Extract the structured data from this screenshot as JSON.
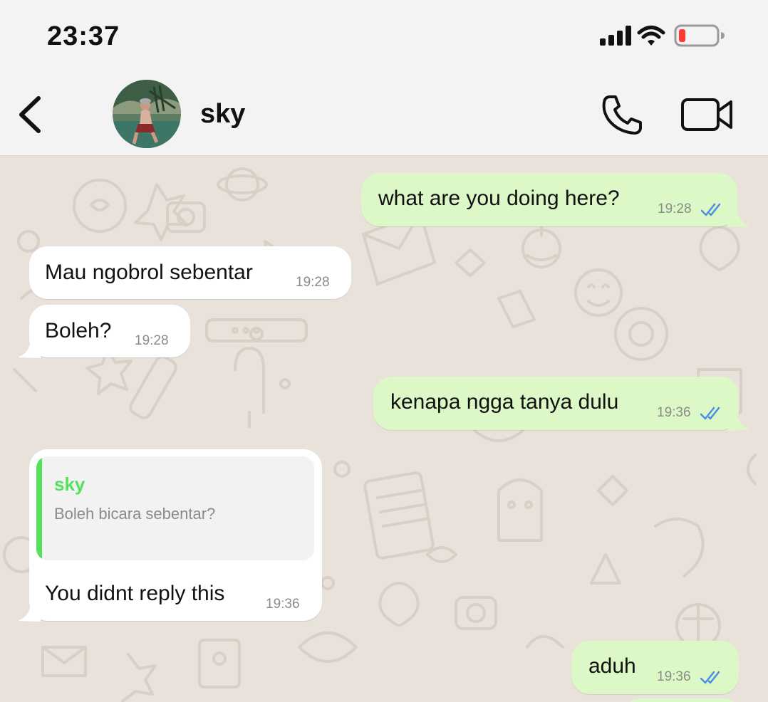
{
  "status_bar": {
    "time": "23:37",
    "signal_icon": "cellular-signal-icon",
    "wifi_icon": "wifi-icon",
    "battery_icon": "battery-low-icon",
    "battery_color": "#ff3b30"
  },
  "header": {
    "back_icon": "chevron-left-icon",
    "contact_name": "sky",
    "call_icon": "phone-icon",
    "video_icon": "video-camera-icon"
  },
  "colors": {
    "outgoing_bubble": "#dcf8c6",
    "incoming_bubble": "#ffffff",
    "read_ticks": "#4a90e2",
    "reply_accent": "#55e15a",
    "chat_background": "#e9e2db"
  },
  "messages": [
    {
      "direction": "outgoing",
      "text": "what are you doing here?",
      "time": "19:28",
      "read": true
    },
    {
      "direction": "incoming",
      "text": "Mau ngobrol sebentar",
      "time": "19:28"
    },
    {
      "direction": "incoming",
      "text": "Boleh?",
      "time": "19:28"
    },
    {
      "direction": "outgoing",
      "text": "kenapa ngga tanya dulu",
      "time": "19:36",
      "read": true
    },
    {
      "direction": "incoming",
      "reply_to": {
        "author": "sky",
        "text": "Boleh bicara sebentar?"
      },
      "text": "You didnt reply this",
      "time": "19:36"
    },
    {
      "direction": "outgoing",
      "text": "aduh",
      "time": "19:36",
      "read": true
    }
  ]
}
